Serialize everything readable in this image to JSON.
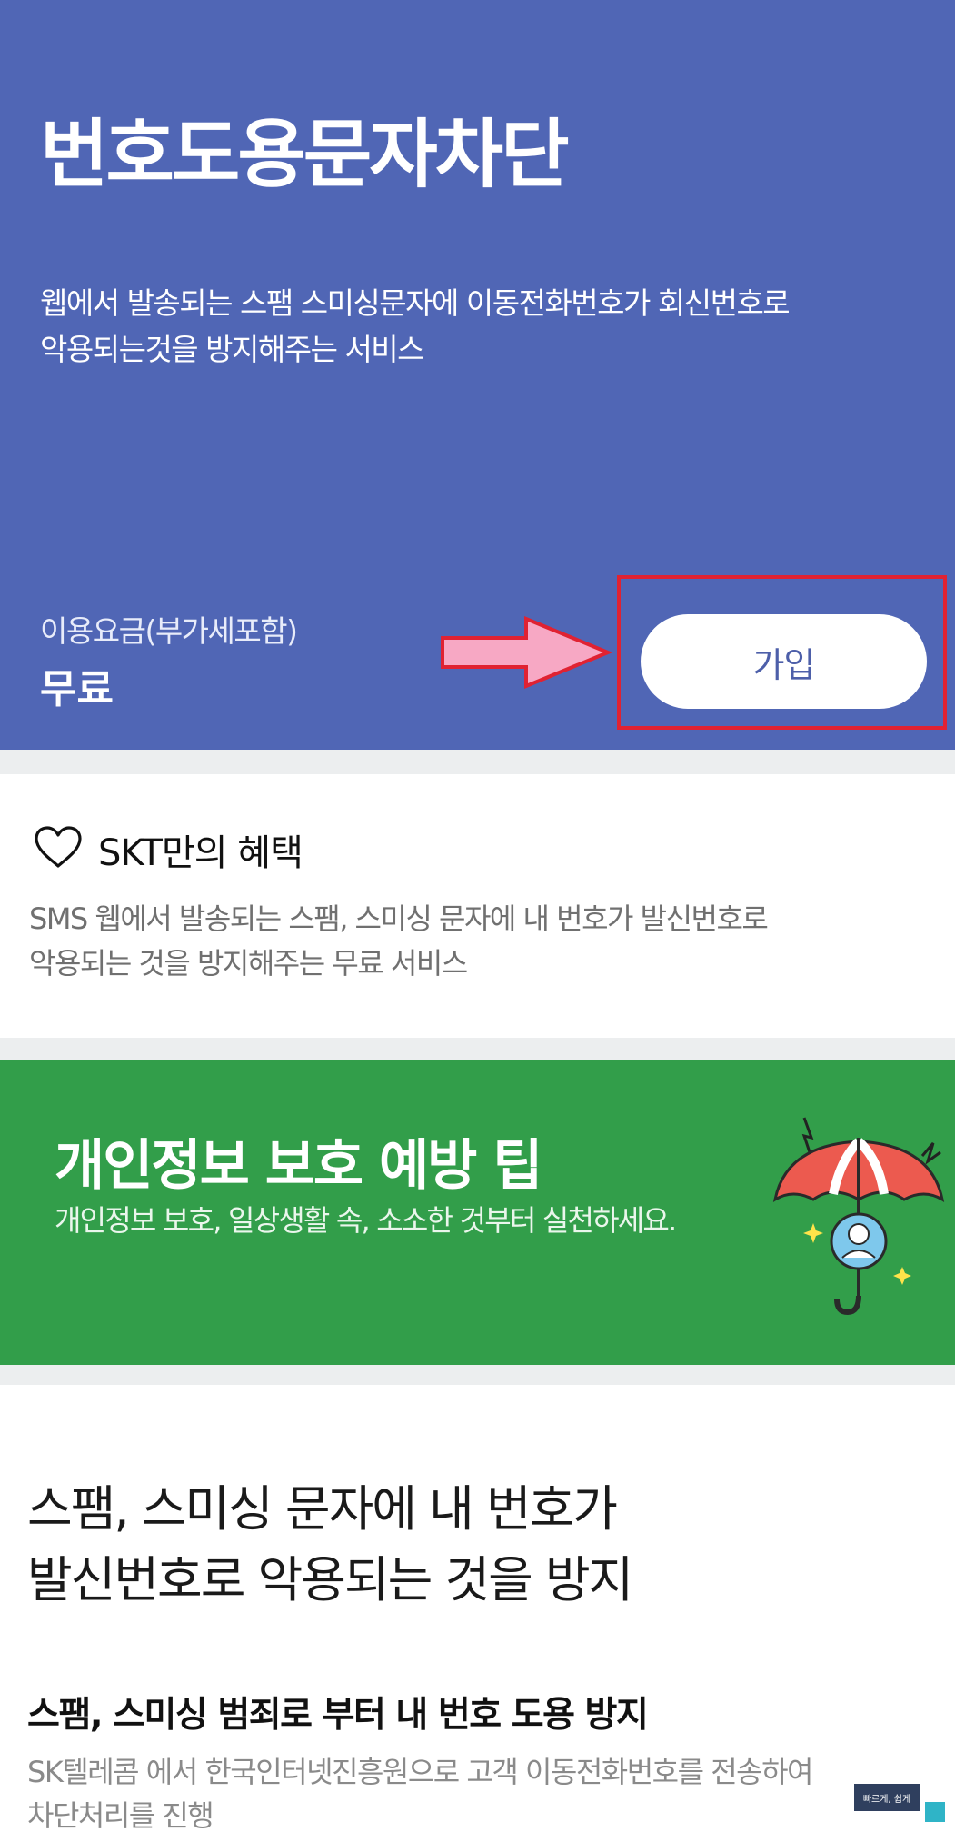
{
  "hero": {
    "title": "번호도용문자차단",
    "description_line1": "웹에서 발송되는 스팸 스미싱문자에 이동전화번호가 회신번호로",
    "description_line2": "악용되는것을 방지해주는 서비스",
    "price_label": "이용요금(부가세포함)",
    "price_value": "무료",
    "join_label": "가입",
    "background_color": "#5066b5"
  },
  "benefit": {
    "title": "SKT만의 혜택",
    "description_line1": "SMS 웹에서 발송되는 스팸, 스미싱 문자에 내 번호가 발신번호로",
    "description_line2": "악용되는 것을 방지해주는 무료 서비스"
  },
  "tip_banner": {
    "title": "개인정보 보호 예방 팁",
    "description": "개인정보 보호, 일상생활 속, 소소한 것부터 실천하세요.",
    "background_color": "#329e4a"
  },
  "detail": {
    "heading_line1": "스팸, 스미싱 문자에 내 번호가",
    "heading_line2": "발신번호로 악용되는 것을 방지",
    "subheading": "스팸, 스미싱 범죄로 부터 내 번호 도용 방지",
    "description_line1": "SK텔레콤 에서 한국인터넷진흥원으로 고객 이동전화번호를 전송하여",
    "description_line2": "차단처리를 진행"
  },
  "watermark": {
    "text": "빠르게, 쉽게"
  },
  "colors": {
    "highlight_border": "#e02232",
    "arrow_fill": "#f7a8c4"
  },
  "icons": [
    "heart-icon",
    "arrow-icon",
    "umbrella-icon"
  ]
}
